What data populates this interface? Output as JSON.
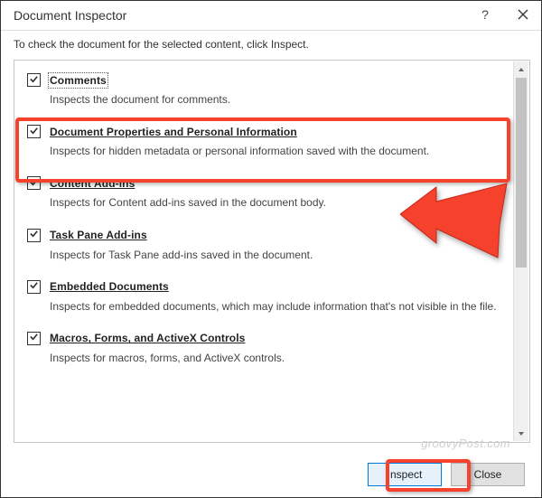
{
  "window": {
    "title": "Document Inspector",
    "help": "?",
    "subhead": "To check the document for the selected content, click Inspect."
  },
  "items": [
    {
      "title": "Comments",
      "desc": "Inspects the document for comments.",
      "focused": true
    },
    {
      "title": "Document Properties and Personal Information",
      "desc": "Inspects for hidden metadata or personal information saved with the document.",
      "focused": false
    },
    {
      "title": "Content Add-ins",
      "desc": "Inspects for Content add-ins saved in the document body.",
      "focused": false
    },
    {
      "title": "Task Pane Add-ins",
      "desc": "Inspects for Task Pane add-ins saved in the document.",
      "focused": false
    },
    {
      "title": "Embedded Documents",
      "desc": "Inspects for embedded documents, which may include information that's not visible in the file.",
      "focused": false
    },
    {
      "title": "Macros, Forms, and ActiveX Controls",
      "desc": "Inspects for macros, forms, and ActiveX controls.",
      "focused": false
    }
  ],
  "footer": {
    "inspect": "Inspect",
    "close": "Close"
  },
  "watermark": "groovyPost.com"
}
